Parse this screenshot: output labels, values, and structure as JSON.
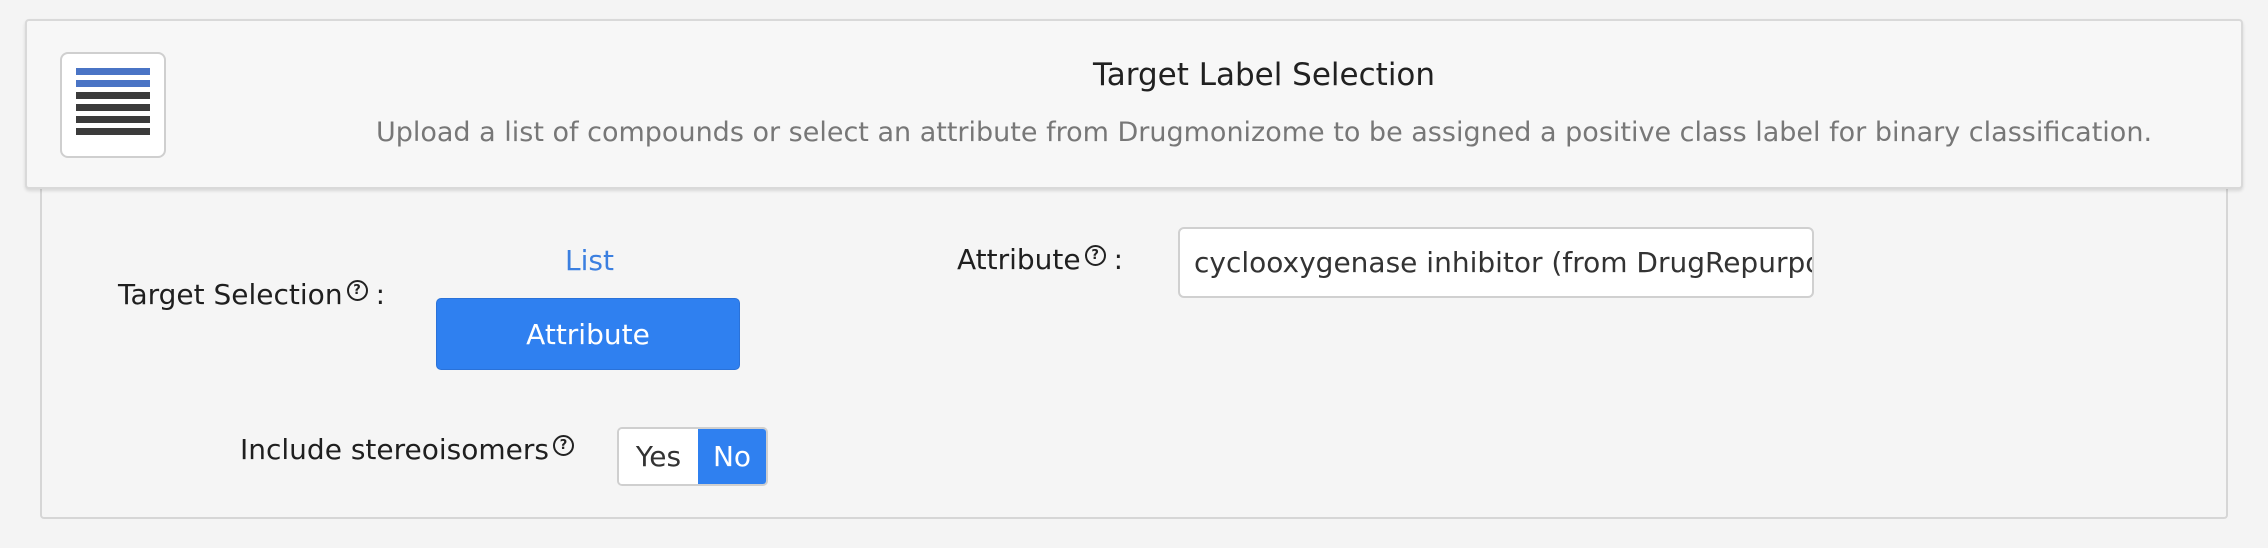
{
  "header": {
    "title": "Target Label Selection",
    "description": "Upload a list of compounds or select an attribute from Drugmonizome to be assigned a positive class label for binary classification.",
    "icon": "list-lines-icon"
  },
  "target_selection": {
    "label": "Target Selection",
    "help": "?",
    "suffix": ":",
    "options": [
      "List",
      "Attribute"
    ],
    "selected": "Attribute"
  },
  "attribute": {
    "label": "Attribute",
    "help": "?",
    "suffix": ":",
    "value": "cyclooxygenase inhibitor (from DrugRepurpos"
  },
  "stereoisomers": {
    "label": "Include stereoisomers",
    "help": "?",
    "yes": "Yes",
    "no": "No",
    "selected": "No"
  },
  "colors": {
    "accent": "#2f80f0",
    "link": "#3b7fe0"
  }
}
